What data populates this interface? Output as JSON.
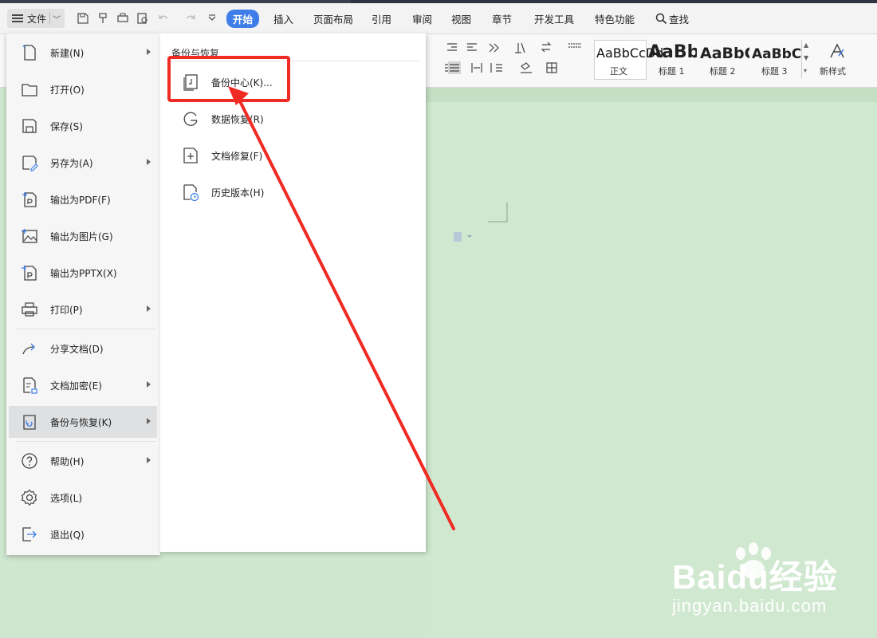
{
  "titlebar": {
    "file_label": "文件"
  },
  "tabs": [
    {
      "label": "开始",
      "active": true
    },
    {
      "label": "插入"
    },
    {
      "label": "页面布局"
    },
    {
      "label": "引用"
    },
    {
      "label": "审阅"
    },
    {
      "label": "视图"
    },
    {
      "label": "章节"
    },
    {
      "label": "开发工具"
    },
    {
      "label": "特色功能"
    },
    {
      "label": "查找"
    }
  ],
  "ribbon": {
    "styles": [
      {
        "sample": "AaBbCcDd",
        "label": "正文"
      },
      {
        "sample": "AaBb",
        "label": "标题 1"
      },
      {
        "sample": "AaBbC",
        "label": "标题 2"
      },
      {
        "sample": "AaBbC",
        "label": "标题 3"
      }
    ],
    "new_style_label": "新样式"
  },
  "file_menu": {
    "items": [
      {
        "label": "新建(N)",
        "icon": "new-doc-icon",
        "submenu": true
      },
      {
        "label": "打开(O)",
        "icon": "folder-icon"
      },
      {
        "label": "保存(S)",
        "icon": "save-icon"
      },
      {
        "label": "另存为(A)",
        "icon": "save-as-icon",
        "submenu": true
      },
      {
        "label": "输出为PDF(F)",
        "icon": "pdf-export-icon"
      },
      {
        "label": "输出为图片(G)",
        "icon": "image-export-icon"
      },
      {
        "label": "输出为PPTX(X)",
        "icon": "pptx-export-icon"
      },
      {
        "label": "打印(P)",
        "icon": "printer-icon",
        "submenu": true
      },
      {
        "label": "分享文档(D)",
        "icon": "share-icon"
      },
      {
        "label": "文档加密(E)",
        "icon": "encrypt-icon",
        "submenu": true
      },
      {
        "label": "备份与恢复(K)",
        "icon": "backup-restore-icon",
        "submenu": true,
        "selected": true
      },
      {
        "label": "帮助(H)",
        "icon": "help-icon",
        "submenu": true
      },
      {
        "label": "选项(L)",
        "icon": "gear-icon"
      },
      {
        "label": "退出(Q)",
        "icon": "exit-icon"
      }
    ]
  },
  "backup_submenu": {
    "title": "备份与恢复",
    "items": [
      {
        "label": "备份中心(K)...",
        "icon": "backup-center-icon"
      },
      {
        "label": "数据恢复(R)",
        "icon": "data-recovery-icon"
      },
      {
        "label": "文档修复(F)",
        "icon": "doc-repair-icon"
      },
      {
        "label": "历史版本(H)",
        "icon": "history-version-icon"
      }
    ]
  },
  "watermark": {
    "brand": "Baidu经验",
    "url": "jingyan.baidu.com"
  },
  "colors": {
    "accent": "#3f7ee8",
    "highlight": "#ef2b23",
    "doc_bg": "#cfe8cf"
  }
}
